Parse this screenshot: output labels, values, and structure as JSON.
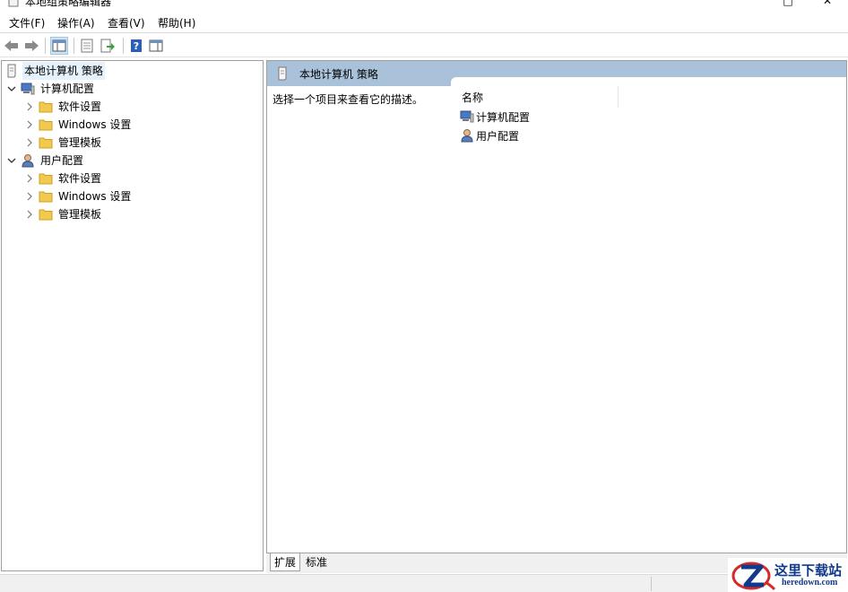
{
  "window": {
    "title": "本地组策略编辑器",
    "minimize_glyph": "—",
    "maximize_glyph": "□",
    "close_glyph": "✕"
  },
  "menu": [
    {
      "label": "文件(F)"
    },
    {
      "label": "操作(A)"
    },
    {
      "label": "查看(V)"
    },
    {
      "label": "帮助(H)"
    }
  ],
  "toolbar": {
    "icons": [
      "back-arrow-icon",
      "forward-arrow-icon",
      "show-hide-tree-icon",
      "properties-icon",
      "export-list-icon",
      "help-icon",
      "show-hide-action-pane-icon"
    ]
  },
  "tree": {
    "root": "本地计算机 策略",
    "computer_config": "计算机配置",
    "user_config": "用户配置",
    "software_settings": "软件设置",
    "windows_settings": "Windows 设置",
    "admin_templates": "管理模板"
  },
  "right_pane": {
    "header": "本地计算机 策略",
    "description": "选择一个项目来查看它的描述。",
    "column_name": "名称",
    "items": [
      "计算机配置",
      "用户配置"
    ]
  },
  "tabs": {
    "extended": "扩展",
    "standard": "标准"
  },
  "watermark": {
    "title": "这里下载站",
    "url": "heredown.com"
  },
  "colors": {
    "header_bg": "#a9c2da",
    "selection_bg": "#e5f1fb",
    "folder": "#f2c94c",
    "watermark_red": "#d42a2a",
    "watermark_blue": "#123a8a"
  }
}
